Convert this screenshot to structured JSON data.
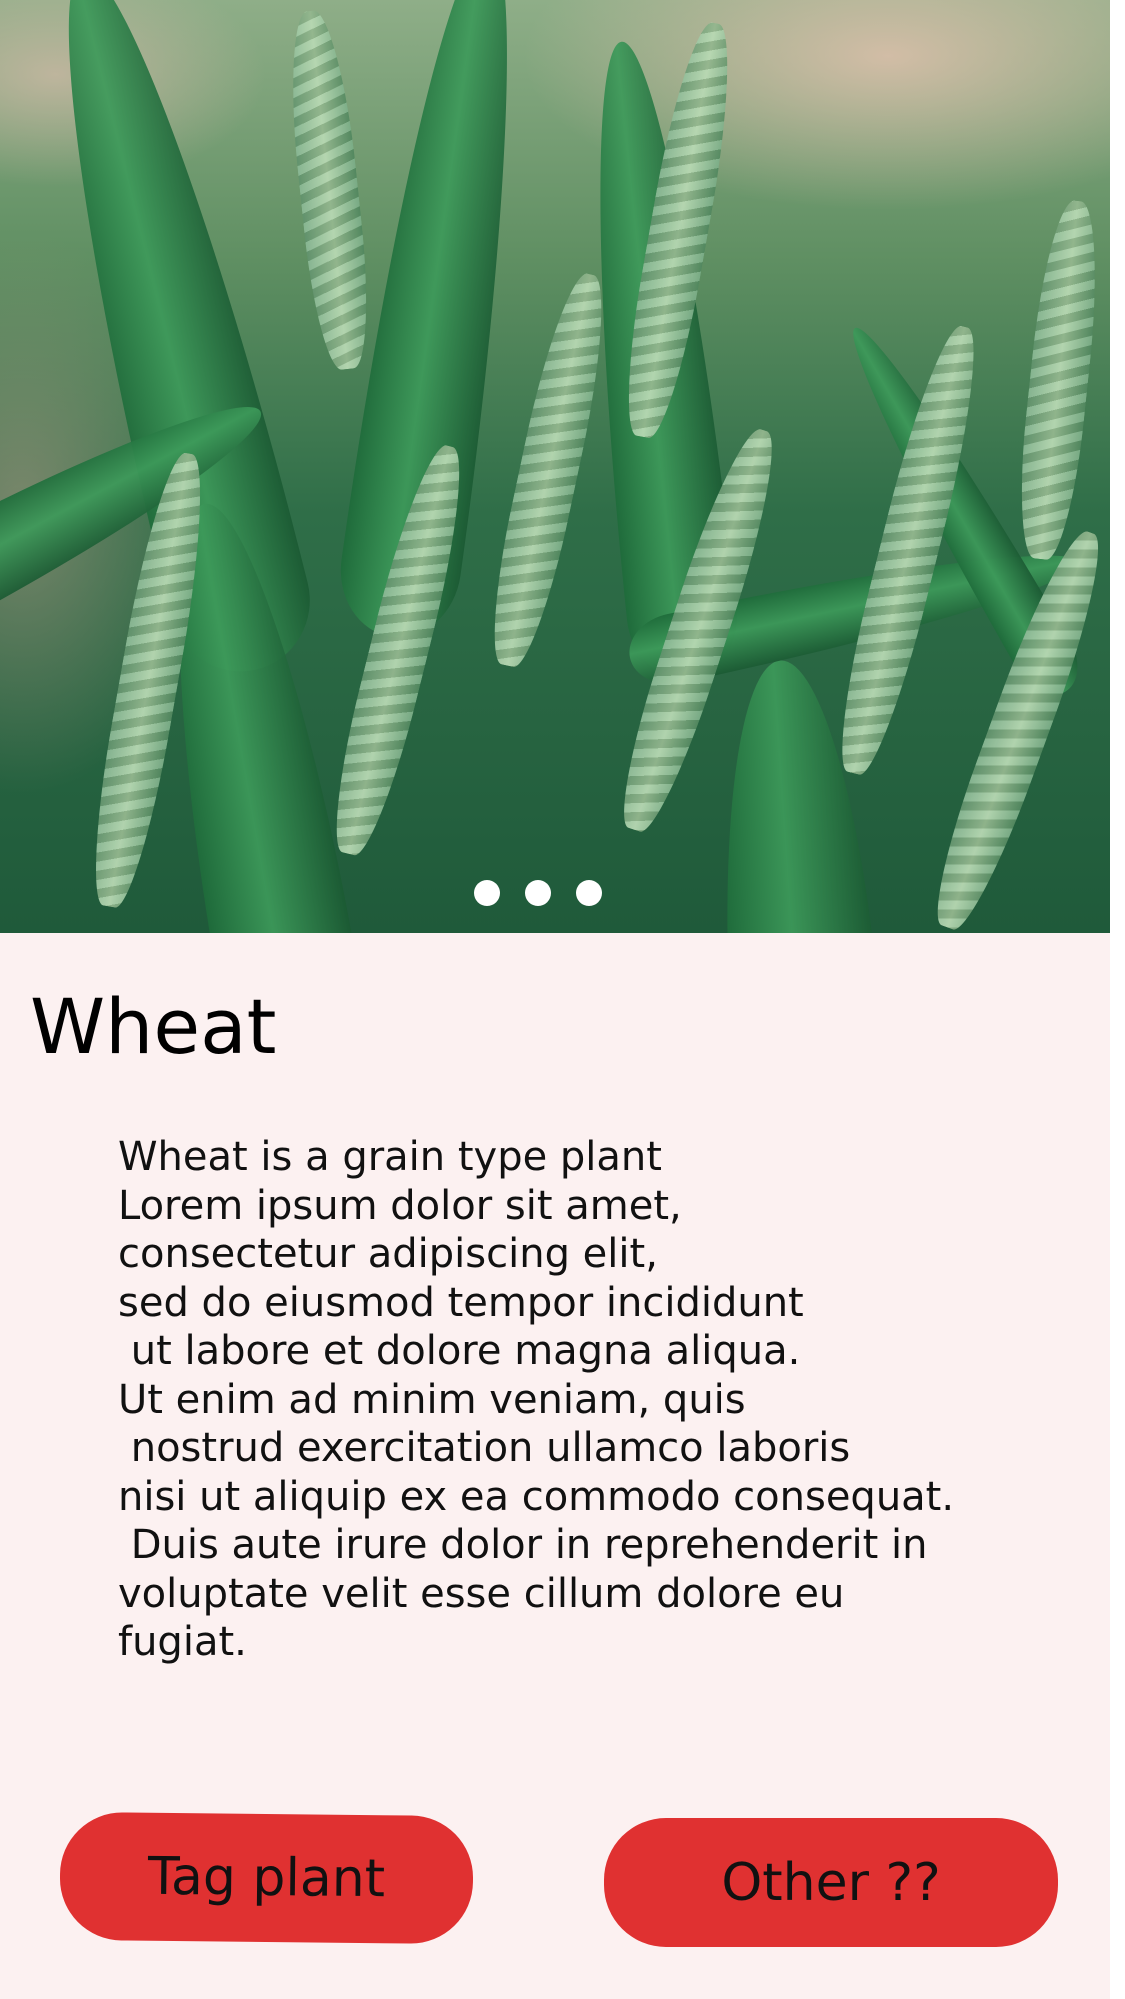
{
  "hero": {
    "image": "wheat-plants-photo",
    "carousel_dot_count": 3
  },
  "plant": {
    "title": "Wheat",
    "description_lines": [
      "Wheat is a grain type plant",
      "Lorem ipsum dolor sit amet,",
      "consectetur adipiscing elit,",
      "sed do eiusmod tempor incididunt",
      " ut labore et dolore magna aliqua.",
      "Ut enim ad minim veniam, quis",
      " nostrud exercitation ullamco laboris",
      "nisi ut aliquip ex ea commodo consequat.",
      " Duis aute irure dolor in reprehenderit in",
      "voluptate velit esse cillum dolore eu",
      "fugiat."
    ]
  },
  "actions": {
    "tag_label": "Tag plant",
    "other_label": "Other ??"
  },
  "colors": {
    "background": "#fcf1f1",
    "button": "#e03131",
    "dot": "#ffffff"
  }
}
